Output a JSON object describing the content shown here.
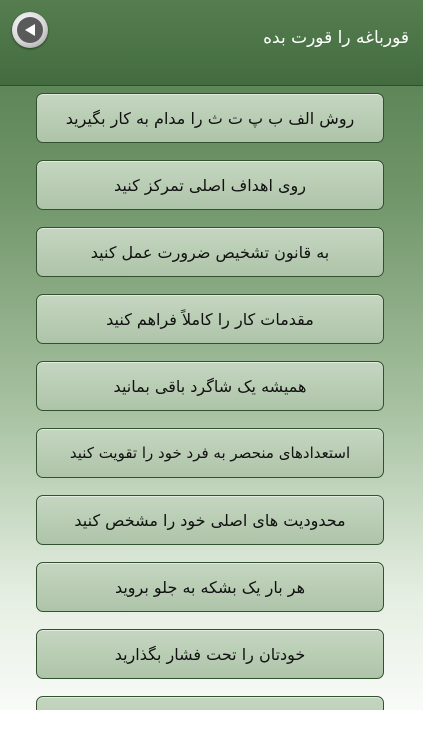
{
  "header": {
    "title": "قورباغه را قورت بده",
    "back_icon": "back-arrow-icon"
  },
  "list": {
    "items": [
      "روش الف ب پ ت ث را مدام به کار بگیرید",
      "روی اهداف اصلی تمرکز کنید",
      "به قانون تشخیص ضرورت عمل کنید",
      "مقدمات کار را کاملاً فراهم کنید",
      "همیشه یک شاگرد باقی بمانید",
      "استعدادهای منحصر به فرد خود را تقویت کنید",
      "محدودیت های اصلی خود را مشخص کنید",
      "هر بار یک بشکه به جلو بروید",
      "خودتان را تحت فشار بگذارید",
      ""
    ]
  }
}
